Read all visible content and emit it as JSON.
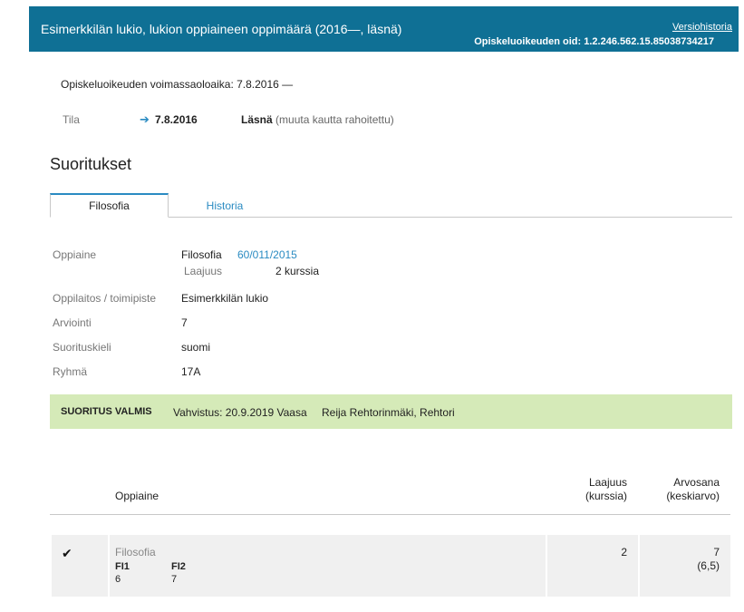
{
  "header": {
    "title": "Esimerkkilän lukio, lukion oppiaineen oppimäärä (2016—, läsnä)",
    "version_link": "Versiohistoria",
    "oid_text": "Opiskeluoikeuden oid: 1.2.246.562.15.85038734217"
  },
  "validity": "Opiskeluoikeuden voimassaoloaika: 7.8.2016 —",
  "tila": {
    "label": "Tila",
    "arrow": "➔",
    "date": "7.8.2016",
    "status": "Läsnä",
    "funding": "(muuta kautta rahoitettu)"
  },
  "section_title": "Suoritukset",
  "tabs": [
    {
      "label": "Filosofia",
      "active": true
    },
    {
      "label": "Historia",
      "active": false
    }
  ],
  "properties": {
    "oppiaine_label": "Oppiaine",
    "oppiaine_value": "Filosofia",
    "oppiaine_link": "60/011/2015",
    "laajuus_label": "Laajuus",
    "laajuus_value": "2 kurssia",
    "oppilaitos_label": "Oppilaitos / toimipiste",
    "oppilaitos_value": "Esimerkkilän lukio",
    "arviointi_label": "Arviointi",
    "arviointi_value": "7",
    "suorituskieli_label": "Suorituskieli",
    "suorituskieli_value": "suomi",
    "ryhma_label": "Ryhmä",
    "ryhma_value": "17A"
  },
  "valmis": {
    "status": "SUORITUS VALMIS",
    "vahvistus": "Vahvistus: 20.9.2019 Vaasa",
    "person": "Reija Rehtorinmäki, Rehtori"
  },
  "table": {
    "col_oppiaine": "Oppiaine",
    "col_laajuus_1": "Laajuus",
    "col_laajuus_2": "(kurssia)",
    "col_arvosana_1": "Arvosana",
    "col_arvosana_2": "(keskiarvo)",
    "row": {
      "check": "✔",
      "subject": "Filosofia",
      "courses": [
        {
          "code": "FI1",
          "grade": "6"
        },
        {
          "code": "FI2",
          "grade": "7"
        }
      ],
      "laajuus": "2",
      "arvosana": "7",
      "keskiarvo": "(6,5)"
    }
  }
}
